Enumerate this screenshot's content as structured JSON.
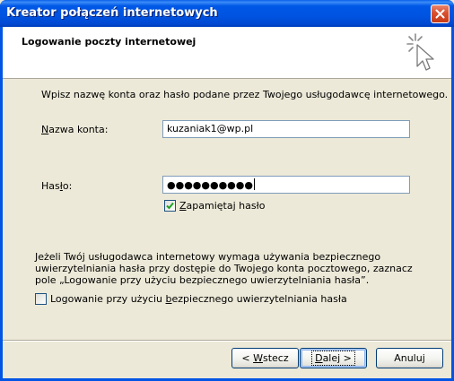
{
  "window": {
    "title": "Kreator połączeń internetowych",
    "close_icon": "close-x-icon"
  },
  "header": {
    "title": "Logowanie poczty internetowej",
    "icon": "wizard-sparkle-cursor-icon"
  },
  "intro": "Wpisz nazwę konta oraz hasło podane przez Twojego usługodawcę internetowego.",
  "account": {
    "label_pre": "",
    "label_key": "N",
    "label_post": "azwa konta:",
    "value": "kuzaniak1@wp.pl"
  },
  "password": {
    "label_pre": "Has",
    "label_key": "ł",
    "label_post": "o:",
    "masked_value": "●●●●●●●●●●"
  },
  "remember": {
    "label_pre": "",
    "label_key": "Z",
    "label_post": "apamiętaj hasło",
    "checked": true
  },
  "spa_info": "Jeżeli Twój usługodawca internetowy wymaga używania bezpiecznego uwierzytelniania hasła przy dostępie do Twojego konta pocztowego, zaznacz pole „Logowanie przy użyciu bezpiecznego uwierzytelniania hasła”.",
  "spa": {
    "label_pre": "Logowanie przy użyciu ",
    "label_key": "b",
    "label_post": "ezpiecznego uwierzytelniania hasła",
    "checked": false
  },
  "buttons": {
    "back_pre": "< ",
    "back_key": "W",
    "back_post": "stecz",
    "next_pre": "",
    "next_key": "D",
    "next_post": "alej >",
    "cancel": "Anuluj"
  },
  "colors": {
    "titlebar": "#0054e3",
    "dialog_bg": "#ece9d8",
    "close_button": "#d9502f",
    "checkbox_check": "#21a121"
  }
}
